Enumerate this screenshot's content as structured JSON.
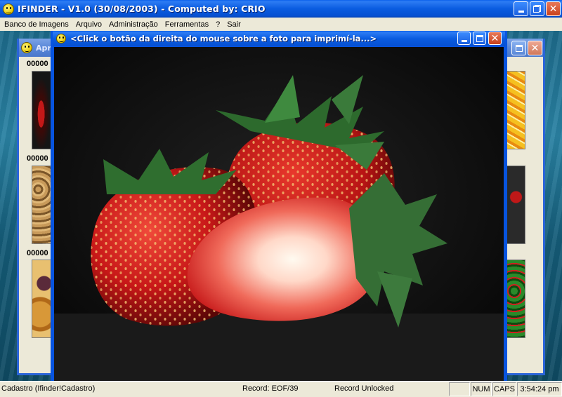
{
  "window": {
    "title": "IFINDER - V1.0 (30/08/2003) - Computed by: CRIO"
  },
  "menu": {
    "items": [
      "Banco de Imagens",
      "Arquivo",
      "Administração",
      "Ferramentas",
      "?",
      "Sair"
    ]
  },
  "background_window": {
    "title": "Apr",
    "thumbnail_labels": [
      "00000",
      "00000",
      "00000"
    ]
  },
  "photo_window": {
    "title": "<Click o botão da direita do mouse sobre a foto para imprimí-la...>",
    "image": "strawberries-photo"
  },
  "status": {
    "form": "Cadastro (Ifinder!Cadastro)",
    "record": "Record: EOF/39",
    "lock": "Record Unlocked",
    "num": "NUM",
    "caps": "CAPS",
    "time": "3:54:24 pm"
  },
  "colors": {
    "title_blue": "#0a5ce0",
    "desktop_teal": "#1d6a8a",
    "close_red": "#c8401c",
    "chrome": "#ece9d8"
  },
  "icons": [
    "smiley-icon",
    "minimize-icon",
    "restore-icon",
    "maximize-icon",
    "close-icon"
  ]
}
